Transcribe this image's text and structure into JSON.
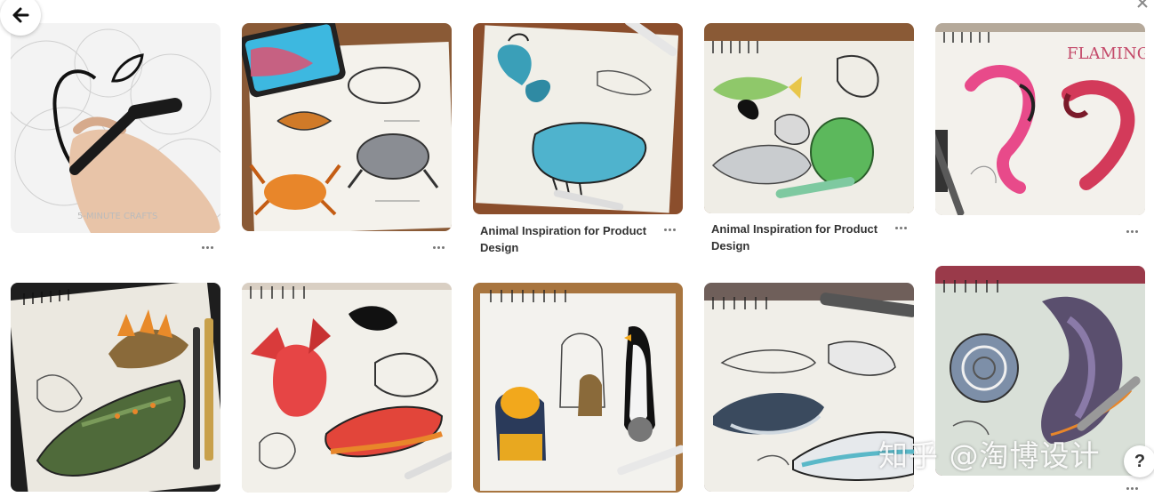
{
  "nav": {
    "back_icon": "arrow-left-icon",
    "close_icon": "close-icon"
  },
  "pins": [
    {
      "id": "apple",
      "title": "",
      "image_text": "5-MINUTE CRAFTS"
    },
    {
      "id": "crab",
      "title": ""
    },
    {
      "id": "butterfly",
      "title": "Animal Inspiration for Product Design"
    },
    {
      "id": "fish",
      "title": "Animal Inspiration for Product Design"
    },
    {
      "id": "flamingo",
      "title": "",
      "image_text": "FLAMINGO"
    },
    {
      "id": "stegosaurus",
      "title": ""
    },
    {
      "id": "charizard",
      "title": ""
    },
    {
      "id": "penguin",
      "title": ""
    },
    {
      "id": "whale",
      "title": ""
    },
    {
      "id": "nautilus",
      "title": ""
    }
  ],
  "watermark": "知乎 @淘博设计",
  "help": {
    "label": "?"
  },
  "colors": {
    "background": "#ffffff",
    "text": "#333333",
    "icon": "#777777"
  }
}
